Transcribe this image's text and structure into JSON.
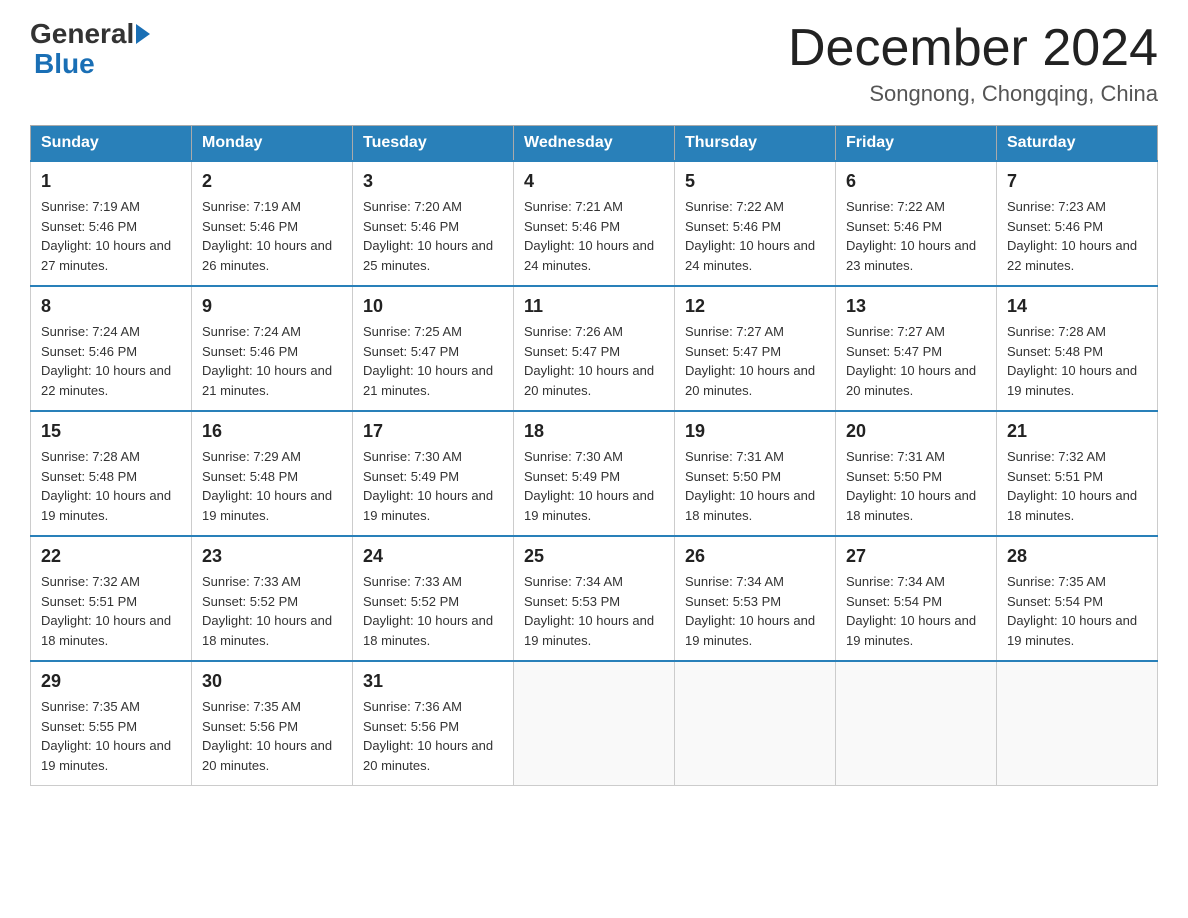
{
  "header": {
    "logo": {
      "part1": "General",
      "part2": "Blue"
    },
    "title": "December 2024",
    "location": "Songnong, Chongqing, China"
  },
  "weekdays": [
    "Sunday",
    "Monday",
    "Tuesday",
    "Wednesday",
    "Thursday",
    "Friday",
    "Saturday"
  ],
  "weeks": [
    [
      {
        "day": "1",
        "sunrise": "7:19 AM",
        "sunset": "5:46 PM",
        "daylight": "10 hours and 27 minutes."
      },
      {
        "day": "2",
        "sunrise": "7:19 AM",
        "sunset": "5:46 PM",
        "daylight": "10 hours and 26 minutes."
      },
      {
        "day": "3",
        "sunrise": "7:20 AM",
        "sunset": "5:46 PM",
        "daylight": "10 hours and 25 minutes."
      },
      {
        "day": "4",
        "sunrise": "7:21 AM",
        "sunset": "5:46 PM",
        "daylight": "10 hours and 24 minutes."
      },
      {
        "day": "5",
        "sunrise": "7:22 AM",
        "sunset": "5:46 PM",
        "daylight": "10 hours and 24 minutes."
      },
      {
        "day": "6",
        "sunrise": "7:22 AM",
        "sunset": "5:46 PM",
        "daylight": "10 hours and 23 minutes."
      },
      {
        "day": "7",
        "sunrise": "7:23 AM",
        "sunset": "5:46 PM",
        "daylight": "10 hours and 22 minutes."
      }
    ],
    [
      {
        "day": "8",
        "sunrise": "7:24 AM",
        "sunset": "5:46 PM",
        "daylight": "10 hours and 22 minutes."
      },
      {
        "day": "9",
        "sunrise": "7:24 AM",
        "sunset": "5:46 PM",
        "daylight": "10 hours and 21 minutes."
      },
      {
        "day": "10",
        "sunrise": "7:25 AM",
        "sunset": "5:47 PM",
        "daylight": "10 hours and 21 minutes."
      },
      {
        "day": "11",
        "sunrise": "7:26 AM",
        "sunset": "5:47 PM",
        "daylight": "10 hours and 20 minutes."
      },
      {
        "day": "12",
        "sunrise": "7:27 AM",
        "sunset": "5:47 PM",
        "daylight": "10 hours and 20 minutes."
      },
      {
        "day": "13",
        "sunrise": "7:27 AM",
        "sunset": "5:47 PM",
        "daylight": "10 hours and 20 minutes."
      },
      {
        "day": "14",
        "sunrise": "7:28 AM",
        "sunset": "5:48 PM",
        "daylight": "10 hours and 19 minutes."
      }
    ],
    [
      {
        "day": "15",
        "sunrise": "7:28 AM",
        "sunset": "5:48 PM",
        "daylight": "10 hours and 19 minutes."
      },
      {
        "day": "16",
        "sunrise": "7:29 AM",
        "sunset": "5:48 PM",
        "daylight": "10 hours and 19 minutes."
      },
      {
        "day": "17",
        "sunrise": "7:30 AM",
        "sunset": "5:49 PM",
        "daylight": "10 hours and 19 minutes."
      },
      {
        "day": "18",
        "sunrise": "7:30 AM",
        "sunset": "5:49 PM",
        "daylight": "10 hours and 19 minutes."
      },
      {
        "day": "19",
        "sunrise": "7:31 AM",
        "sunset": "5:50 PM",
        "daylight": "10 hours and 18 minutes."
      },
      {
        "day": "20",
        "sunrise": "7:31 AM",
        "sunset": "5:50 PM",
        "daylight": "10 hours and 18 minutes."
      },
      {
        "day": "21",
        "sunrise": "7:32 AM",
        "sunset": "5:51 PM",
        "daylight": "10 hours and 18 minutes."
      }
    ],
    [
      {
        "day": "22",
        "sunrise": "7:32 AM",
        "sunset": "5:51 PM",
        "daylight": "10 hours and 18 minutes."
      },
      {
        "day": "23",
        "sunrise": "7:33 AM",
        "sunset": "5:52 PM",
        "daylight": "10 hours and 18 minutes."
      },
      {
        "day": "24",
        "sunrise": "7:33 AM",
        "sunset": "5:52 PM",
        "daylight": "10 hours and 18 minutes."
      },
      {
        "day": "25",
        "sunrise": "7:34 AM",
        "sunset": "5:53 PM",
        "daylight": "10 hours and 19 minutes."
      },
      {
        "day": "26",
        "sunrise": "7:34 AM",
        "sunset": "5:53 PM",
        "daylight": "10 hours and 19 minutes."
      },
      {
        "day": "27",
        "sunrise": "7:34 AM",
        "sunset": "5:54 PM",
        "daylight": "10 hours and 19 minutes."
      },
      {
        "day": "28",
        "sunrise": "7:35 AM",
        "sunset": "5:54 PM",
        "daylight": "10 hours and 19 minutes."
      }
    ],
    [
      {
        "day": "29",
        "sunrise": "7:35 AM",
        "sunset": "5:55 PM",
        "daylight": "10 hours and 19 minutes."
      },
      {
        "day": "30",
        "sunrise": "7:35 AM",
        "sunset": "5:56 PM",
        "daylight": "10 hours and 20 minutes."
      },
      {
        "day": "31",
        "sunrise": "7:36 AM",
        "sunset": "5:56 PM",
        "daylight": "10 hours and 20 minutes."
      },
      null,
      null,
      null,
      null
    ]
  ],
  "labels": {
    "sunrise": "Sunrise:",
    "sunset": "Sunset:",
    "daylight": "Daylight:"
  }
}
